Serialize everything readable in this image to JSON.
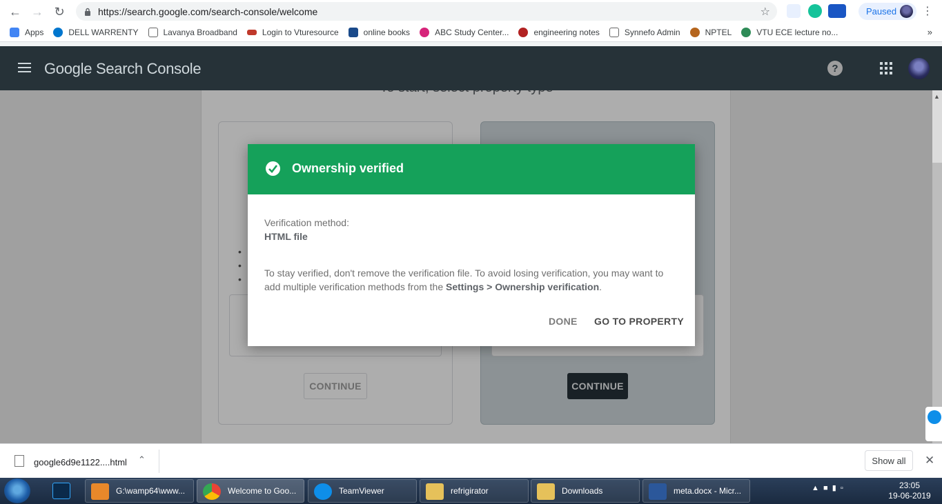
{
  "browser": {
    "url": "https://search.google.com/search-console/welcome",
    "profile_status": "Paused"
  },
  "bookmarks": [
    {
      "label": "Apps",
      "color": "#4285f4"
    },
    {
      "label": "DELL WARRENTY",
      "color": "#0076ce"
    },
    {
      "label": "Lavanya Broadband",
      "color": "#666666"
    },
    {
      "label": "Login to Vturesource",
      "color": "#c0392b"
    },
    {
      "label": "online books",
      "color": "#1a4a8a"
    },
    {
      "label": "ABC Study Center...",
      "color": "#d6247a"
    },
    {
      "label": "engineering notes",
      "color": "#b22222"
    },
    {
      "label": "Synnefo Admin",
      "color": "#666666"
    },
    {
      "label": "NPTEL",
      "color": "#b5651d"
    },
    {
      "label": "VTU ECE lecture no...",
      "color": "#2e8b57"
    }
  ],
  "header": {
    "title": "Google Search Console"
  },
  "page": {
    "heading": "To start, select property type",
    "continue_left": "CONTINUE",
    "continue_right": "CONTINUE"
  },
  "dialog": {
    "title": "Ownership verified",
    "method_label": "Verification method:",
    "method_value": "HTML file",
    "text_before": "To stay verified, don't remove the verification file. To avoid losing verification, you may want to add multiple verification methods from the ",
    "text_bold": "Settings > Ownership verification",
    "text_after": ".",
    "done_label": "DONE",
    "go_label": "GO TO PROPERTY",
    "accent_color": "#15a15a"
  },
  "download_bar": {
    "file_name": "google6d9e1122....html",
    "show_all": "Show all"
  },
  "taskbar": {
    "items": [
      {
        "label": "G:\\wamp64\\www...",
        "color": "#e8882a"
      },
      {
        "label": "Welcome to Goo...",
        "color": "#34a853"
      },
      {
        "label": "TeamViewer",
        "color": "#0e8ee9"
      },
      {
        "label": "refrigirator",
        "color": "#e6c15a"
      },
      {
        "label": "Downloads",
        "color": "#e6c15a"
      },
      {
        "label": "meta.docx - Micr...",
        "color": "#2b579a"
      }
    ],
    "time": "23:05",
    "date": "19-06-2019"
  }
}
